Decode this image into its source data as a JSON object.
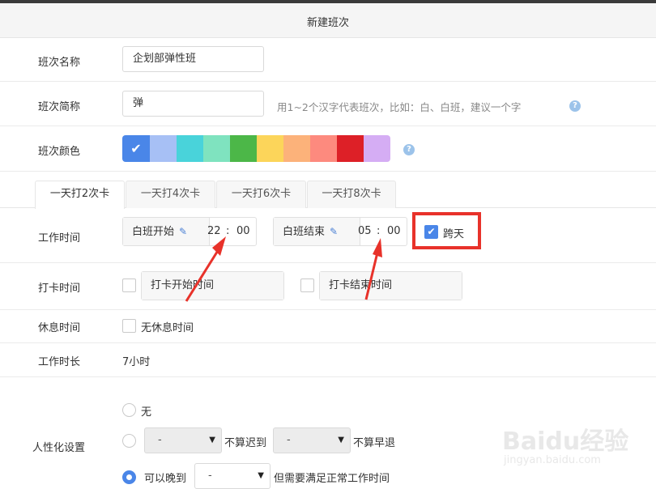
{
  "header": {
    "title": "新建班次"
  },
  "form": {
    "name_label": "班次名称",
    "name_value": "企划部弹性班",
    "short_label": "班次简称",
    "short_value": "弹",
    "short_hint": "用1~2个汉字代表班次，比如：白、白班，建议一个字",
    "color_label": "班次颜色",
    "colors": [
      "#4a86e8",
      "#a7c0f5",
      "#49d3da",
      "#7fe3bf",
      "#4cb748",
      "#fcd55a",
      "#fcb27a",
      "#fd8a7e",
      "#dd2027",
      "#d5adf4"
    ]
  },
  "tabs": [
    "一天打2次卡",
    "一天打4次卡",
    "一天打6次卡",
    "一天打8次卡"
  ],
  "work_time": {
    "label": "工作时间",
    "start_label": "白班开始",
    "start_hour": "22",
    "start_min": "00",
    "end_label": "白班结束",
    "end_hour": "05",
    "end_min": "00",
    "colon": ":",
    "cross_day_label": "跨天",
    "cross_day_checked": true
  },
  "punch_time": {
    "label": "打卡时间",
    "start_label": "打卡开始时间",
    "end_label": "打卡结束时间"
  },
  "rest_time": {
    "label": "休息时间",
    "option": "无休息时间"
  },
  "duration": {
    "label": "工作时长",
    "value": "7小时"
  },
  "humanize": {
    "label": "人性化设置",
    "opt_none": "无",
    "select_dash": "-",
    "not_late": "不算迟到",
    "not_early": "不算早退",
    "can_late": "可以晚到",
    "must_full": "但需要满足正常工作时间"
  },
  "watermark": {
    "text": "Baidu经验",
    "url": "jingyan.baidu.com"
  },
  "icons": {
    "check": "check-icon",
    "pencil": "pencil-icon",
    "help": "help-icon",
    "caret": "caret-down-icon"
  }
}
